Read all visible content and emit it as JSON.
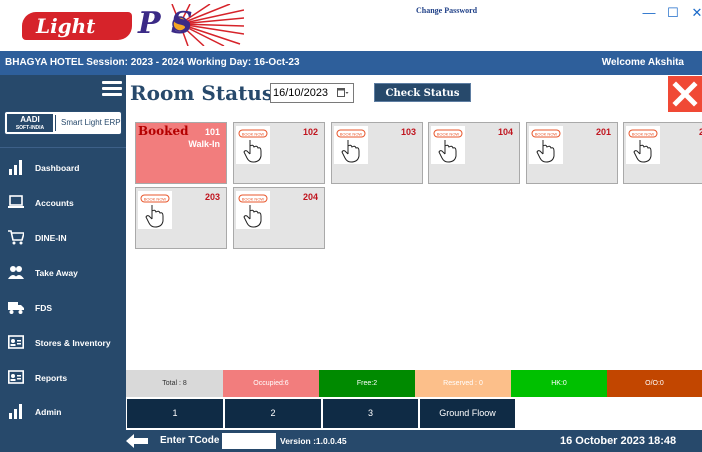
{
  "window": {
    "change_password": "Change Password",
    "minimize_glyph": "—",
    "maximize_glyph": "☐",
    "close_glyph": "✕"
  },
  "logo": {
    "light": "Light",
    "pos": "P  S",
    "icon": "starburst-logo-icon"
  },
  "infobar": {
    "session": "BHAGYA HOTEL  Session:  2023 - 2024 Working Day: 16-Oct-23",
    "welcome": "Welcome  Akshita"
  },
  "sidebar": {
    "brand_logo_top": "AADI",
    "brand_logo_bottom": "SOFT-INDIA",
    "brand_text": "Smart Light ERP",
    "items": [
      {
        "label": "Dashboard",
        "icon": "bar-chart-icon"
      },
      {
        "label": "Accounts",
        "icon": "laptop-icon"
      },
      {
        "label": "DINE-IN",
        "icon": "cart-icon"
      },
      {
        "label": "Take Away",
        "icon": "people-icon"
      },
      {
        "label": "FDS",
        "icon": "truck-icon"
      },
      {
        "label": "Stores & Inventory",
        "icon": "id-card-icon"
      },
      {
        "label": "Reports",
        "icon": "report-icon"
      },
      {
        "label": "Admin",
        "icon": "bar-chart-icon"
      }
    ]
  },
  "main": {
    "title": "Room Status",
    "date_value": "16/10/2023",
    "check_status": "Check Status"
  },
  "rooms": [
    {
      "number": "101",
      "status": "Booked",
      "type": "Walk-In",
      "booked": true
    },
    {
      "number": "102",
      "booked": false
    },
    {
      "number": "103",
      "booked": false
    },
    {
      "number": "104",
      "booked": false
    },
    {
      "number": "201",
      "booked": false
    },
    {
      "number": "2",
      "booked": false
    },
    {
      "number": "203",
      "booked": false
    },
    {
      "number": "204",
      "booked": false
    }
  ],
  "book_now_label": "BOOK NOW",
  "legend": [
    {
      "label": "Total : 8",
      "color": "#d9d9d9",
      "text_color": "#333333"
    },
    {
      "label": "Occupied:6",
      "color": "#f27d7d",
      "text_color": "#ffffff"
    },
    {
      "label": "Free:2",
      "color": "#008a00",
      "text_color": "#ffffff"
    },
    {
      "label": "Reserved : 0",
      "color": "#fcbf8a",
      "text_color": "#ffffff"
    },
    {
      "label": "HK:0",
      "color": "#00c000",
      "text_color": "#ffffff"
    },
    {
      "label": "O/O:0",
      "color": "#c24600",
      "text_color": "#ffffff"
    }
  ],
  "floors": [
    {
      "label": "1"
    },
    {
      "label": "2"
    },
    {
      "label": "3"
    },
    {
      "label": "Ground Floow"
    }
  ],
  "bottombar": {
    "tcode_label": "Enter TCode",
    "tcode_value": "",
    "version": "Version :1.0.0.45",
    "date": "16 October 2023",
    "time": "18:48"
  }
}
